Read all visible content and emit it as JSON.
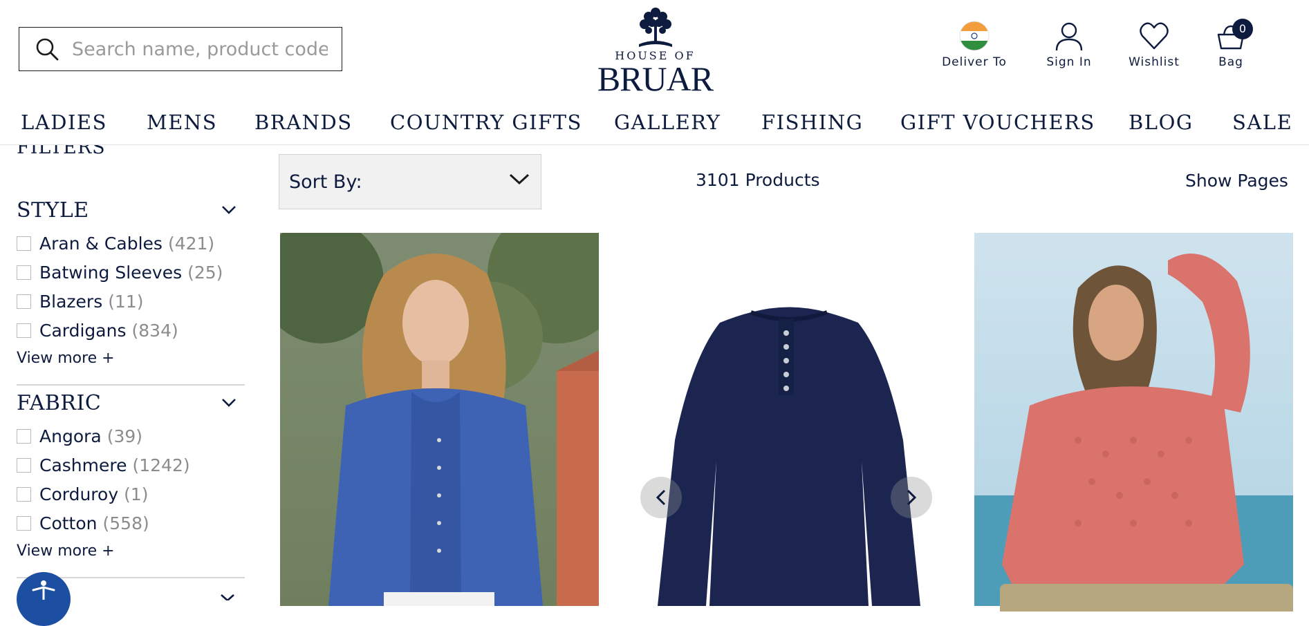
{
  "header": {
    "search": {
      "placeholder": "Search name, product code or keyword",
      "icon": "search-icon"
    },
    "logo": {
      "line1": "HOUSE OF",
      "line2": "BRUAR"
    },
    "actions": [
      {
        "label": "Deliver To",
        "icon": "india-flag-icon"
      },
      {
        "label": "Sign In",
        "icon": "user-icon"
      },
      {
        "label": "Wishlist",
        "icon": "heart-icon"
      },
      {
        "label": "Bag",
        "icon": "bag-icon",
        "badge": "0"
      }
    ]
  },
  "nav": {
    "items": [
      "LADIES",
      "MENS",
      "BRANDS",
      "COUNTRY GIFTS",
      "GALLERY",
      "FISHING",
      "GIFT VOUCHERS",
      "BLOG",
      "SALE"
    ]
  },
  "sidebar": {
    "title": "FILTERS",
    "facets": [
      {
        "title": "STYLE",
        "options": [
          {
            "label": "Aran & Cables",
            "count": "(421)"
          },
          {
            "label": "Batwing Sleeves",
            "count": "(25)"
          },
          {
            "label": "Blazers",
            "count": "(11)"
          },
          {
            "label": "Cardigans",
            "count": "(834)"
          }
        ],
        "view_more": "View more +"
      },
      {
        "title": "FABRIC",
        "options": [
          {
            "label": "Angora",
            "count": "(39)"
          },
          {
            "label": "Cashmere",
            "count": "(1242)"
          },
          {
            "label": "Corduroy",
            "count": "(1)"
          },
          {
            "label": "Cotton",
            "count": "(558)"
          }
        ],
        "view_more": "View more +"
      }
    ]
  },
  "toolbar": {
    "sort_label": "Sort By:",
    "product_count": "3101 Products",
    "show_pages": "Show Pages"
  },
  "colors": {
    "navy": "#0d1b3e",
    "cardigan_blue": "#3f63b4",
    "jumper_navy": "#1b2550",
    "jumper_pink": "#d9736c",
    "accessibility_blue": "#1c4fa1",
    "gold": "#b6a77e"
  }
}
